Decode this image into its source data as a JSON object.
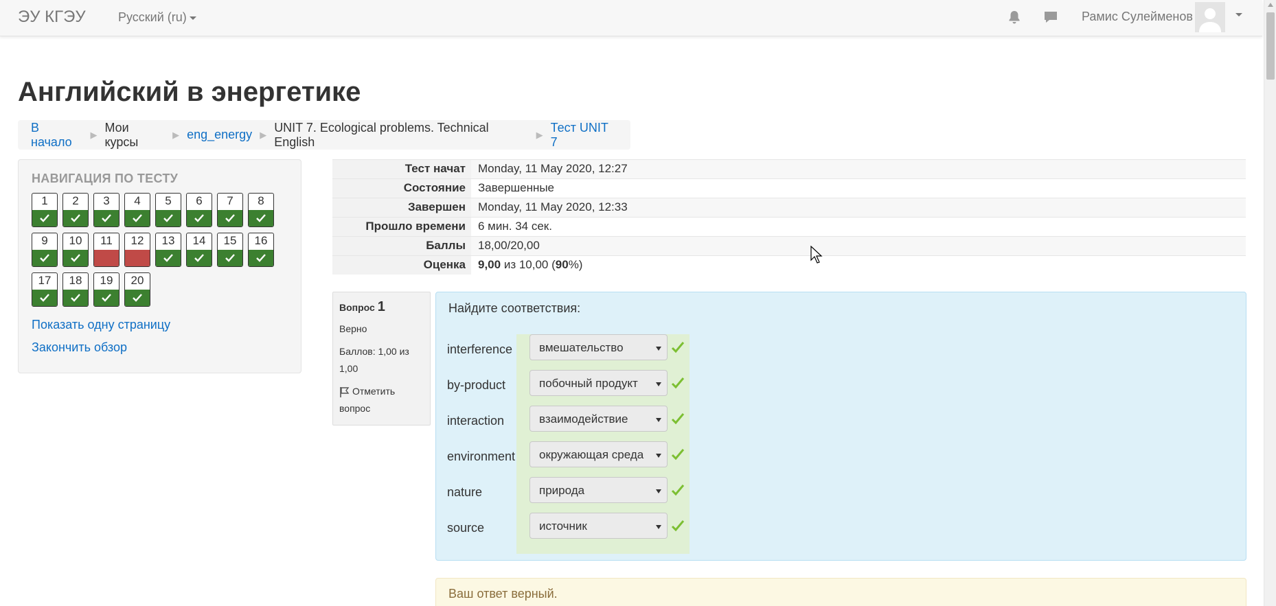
{
  "navbar": {
    "brand": "ЭУ КГЭУ",
    "language": "Русский (ru)",
    "user_name": "Рамис Сулейменов"
  },
  "page": {
    "title": "Английский в энергетике"
  },
  "breadcrumb": [
    {
      "label": "В начало",
      "link": true
    },
    {
      "label": "Мои курсы",
      "link": false
    },
    {
      "label": "eng_energy",
      "link": true
    },
    {
      "label": "UNIT 7. Ecological problems. Technical English",
      "link": false
    },
    {
      "label": "Тест UNIT 7",
      "link": true
    }
  ],
  "quiz_nav": {
    "title": "НАВИГАЦИЯ ПО ТЕСТУ",
    "questions": [
      {
        "num": "1",
        "state": "correct"
      },
      {
        "num": "2",
        "state": "correct"
      },
      {
        "num": "3",
        "state": "correct"
      },
      {
        "num": "4",
        "state": "correct"
      },
      {
        "num": "5",
        "state": "correct"
      },
      {
        "num": "6",
        "state": "correct"
      },
      {
        "num": "7",
        "state": "correct"
      },
      {
        "num": "8",
        "state": "correct"
      },
      {
        "num": "9",
        "state": "correct"
      },
      {
        "num": "10",
        "state": "correct"
      },
      {
        "num": "11",
        "state": "incorrect"
      },
      {
        "num": "12",
        "state": "incorrect"
      },
      {
        "num": "13",
        "state": "correct"
      },
      {
        "num": "14",
        "state": "correct"
      },
      {
        "num": "15",
        "state": "correct"
      },
      {
        "num": "16",
        "state": "correct"
      },
      {
        "num": "17",
        "state": "correct"
      },
      {
        "num": "18",
        "state": "correct"
      },
      {
        "num": "19",
        "state": "correct"
      },
      {
        "num": "20",
        "state": "correct"
      }
    ],
    "show_one_page": "Показать одну страницу",
    "finish_review": "Закончить обзор"
  },
  "summary": {
    "started_label": "Тест начат",
    "started_value": "Monday, 11 May 2020, 12:27",
    "state_label": "Состояние",
    "state_value": "Завершенные",
    "completed_label": "Завершен",
    "completed_value": "Monday, 11 May 2020, 12:33",
    "time_label": "Прошло времени",
    "time_value": "6 мин. 34 сек.",
    "marks_label": "Баллы",
    "marks_value": "18,00/20,00",
    "grade_label": "Оценка",
    "grade_score": "9,00",
    "grade_of": " из 10,00 (",
    "grade_percent": "90",
    "grade_tail": "%)"
  },
  "question": {
    "label": "Вопрос",
    "number": "1",
    "status": "Верно",
    "marks": "Баллов: 1,00 из 1,00",
    "flag": "Отметить вопрос",
    "text": "Найдите соответствия:",
    "answers": [
      {
        "term": "interference",
        "choice": "вмешательство"
      },
      {
        "term": "by-product",
        "choice": "побочный продукт"
      },
      {
        "term": "interaction",
        "choice": "взаимодействие"
      },
      {
        "term": "environment",
        "choice": "окружающая среда"
      },
      {
        "term": "nature",
        "choice": "природа"
      },
      {
        "term": "source",
        "choice": "источник"
      }
    ],
    "feedback": "Ваш ответ верный."
  },
  "colors": {
    "correct": "#3c8030",
    "incorrect": "#c04a47",
    "link": "#0f6fc5",
    "question_bg": "#def1f9",
    "answer_bg": "#e0f0d4",
    "check": "#7cbf32"
  }
}
